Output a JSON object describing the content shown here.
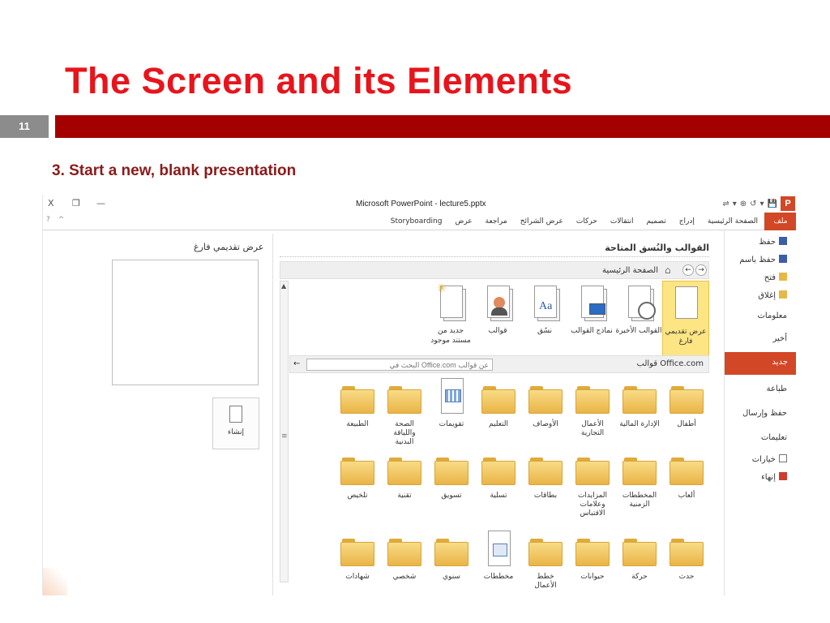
{
  "slide": {
    "title": "The Screen and its Elements",
    "number": "11",
    "subtitle": "3. Start a new, blank presentation",
    "accent": "#e8141b",
    "bar_color": "#a40000"
  },
  "window": {
    "title": "Microsoft PowerPoint - lecture5.pptx",
    "controls": {
      "close": "X",
      "restore": "❐",
      "minimize": "—"
    },
    "app_icon": "P",
    "qat": [
      "⇌",
      "▾",
      "⊕",
      "↺",
      "▾",
      "💾"
    ]
  },
  "ribbon": {
    "tabs": [
      "ملف",
      "الصفحة الرئيسية",
      "إدراج",
      "تصميم",
      "انتقالات",
      "حركات",
      "عرض الشرائح",
      "مراجعة",
      "عرض",
      "Storyboarding"
    ],
    "left_icons": [
      "?",
      "^"
    ],
    "file_color": "#d24726"
  },
  "preview": {
    "title": "عرض تقديمي فارغ",
    "create_label": "إنشاء"
  },
  "templates": {
    "section_title": "القوالب والنُسق المتاحة",
    "nav_back": "←",
    "nav_forward": "→",
    "home_icon": "⌂",
    "breadcrumb": "الصفحة الرئيسية",
    "items": [
      {
        "label1": "عرض تقديمي",
        "label2": "فارغ",
        "icon": "blank-document-icon"
      },
      {
        "label1": "القوالب الأخيرة",
        "label2": "",
        "icon": "recent-templates-icon"
      },
      {
        "label1": "نماذج القوالب",
        "label2": "",
        "icon": "sample-templates-icon"
      },
      {
        "label1": "نسُق",
        "label2": "",
        "icon": "themes-icon"
      },
      {
        "label1": "قوالب",
        "label2": "",
        "icon": "my-templates-icon"
      },
      {
        "label1": "جديد من",
        "label2": "مستند موجود",
        "icon": "new-from-existing-icon"
      }
    ],
    "office_label": "قوالب Office.com",
    "search_placeholder": "البحث في Office.com عن قوالب",
    "search_back": "←"
  },
  "folders": {
    "row1": [
      {
        "l1": "أطفال",
        "l2": "",
        "l3": ""
      },
      {
        "l1": "الإدارة المالية",
        "l2": "",
        "l3": ""
      },
      {
        "l1": "الأعمال",
        "l2": "التجارية",
        "l3": ""
      },
      {
        "l1": "الأوصاف",
        "l2": "",
        "l3": ""
      },
      {
        "l1": "التعليم",
        "l2": "",
        "l3": ""
      },
      {
        "l1": "تقويمات",
        "l2": "",
        "l3": ""
      },
      {
        "l1": "الصحة واللياقة",
        "l2": "البدنية",
        "l3": ""
      },
      {
        "l1": "الطبيعة",
        "l2": "",
        "l3": ""
      }
    ],
    "row2": [
      {
        "l1": "ألعاب",
        "l2": "",
        "l3": ""
      },
      {
        "l1": "المخططات",
        "l2": "الزمنية",
        "l3": ""
      },
      {
        "l1": "المزايدات",
        "l2": "وعلامات",
        "l3": "الاقتباس"
      },
      {
        "l1": "بطاقات",
        "l2": "",
        "l3": ""
      },
      {
        "l1": "تسلية",
        "l2": "",
        "l3": ""
      },
      {
        "l1": "تسويق",
        "l2": "",
        "l3": ""
      },
      {
        "l1": "تقنية",
        "l2": "",
        "l3": ""
      },
      {
        "l1": "تلخيص",
        "l2": "",
        "l3": ""
      }
    ],
    "row3": [
      {
        "l1": "حدث",
        "l2": "",
        "l3": ""
      },
      {
        "l1": "حركة",
        "l2": "",
        "l3": ""
      },
      {
        "l1": "حيوانات",
        "l2": "",
        "l3": ""
      },
      {
        "l1": "خطط الأعمال",
        "l2": "",
        "l3": ""
      },
      {
        "l1": "مخططات",
        "l2": "",
        "l3": ""
      },
      {
        "l1": "سنوي",
        "l2": "",
        "l3": ""
      },
      {
        "l1": "شخصي",
        "l2": "",
        "l3": ""
      },
      {
        "l1": "شهادات",
        "l2": "",
        "l3": ""
      }
    ]
  },
  "sidebar": {
    "save": "حفظ",
    "save_as": "حفظ باسم",
    "open": "فتح",
    "close": "إغلاق",
    "info": "معلومات",
    "recent": "أخير",
    "new": "جديد",
    "print": "طباعة",
    "save_send": "حفظ وإرسال",
    "help": "تعليمات",
    "options": "خيارات",
    "exit": "إنهاء"
  }
}
